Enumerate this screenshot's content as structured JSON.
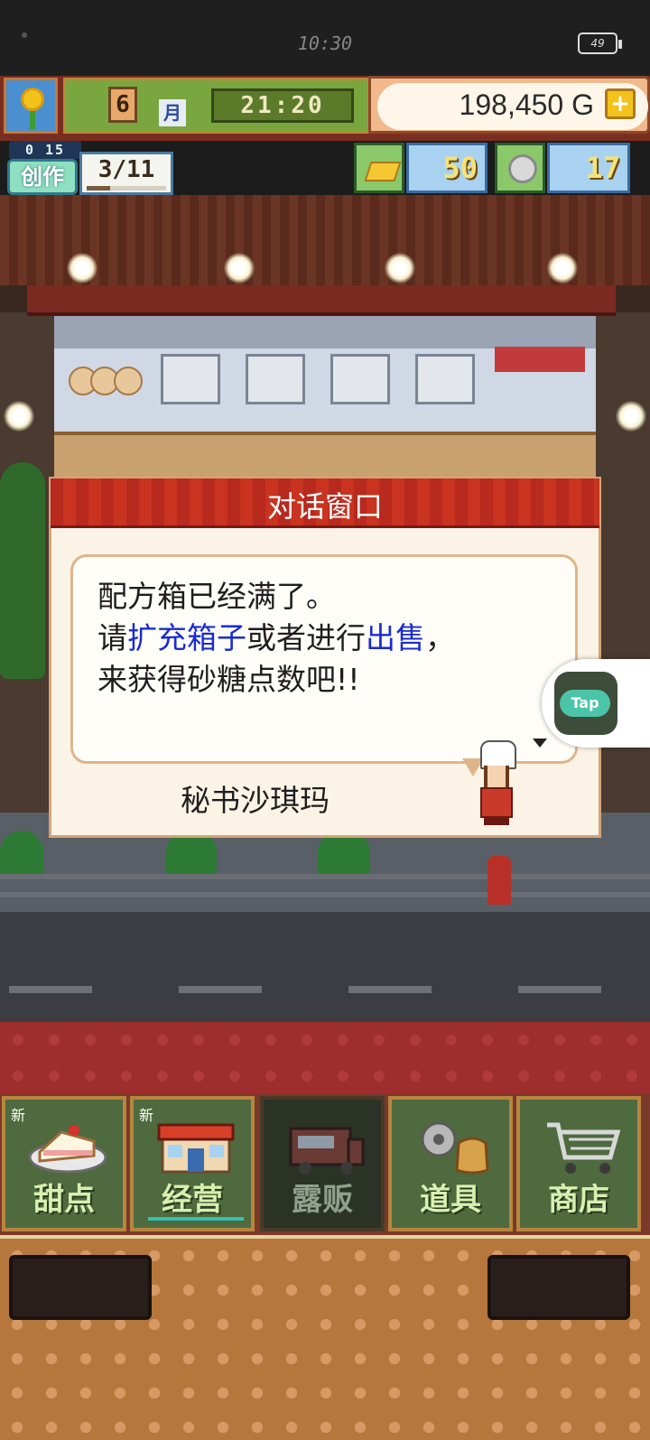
{
  "status_bar": {
    "time": "10:30",
    "battery": "49"
  },
  "hud": {
    "month": "6",
    "month_unit": "月",
    "clock": "21:20",
    "money": "198,450 G",
    "money_add": "+",
    "create_timer": "0 15",
    "create_label": "创作",
    "create_count": "3/11",
    "create_progress": 0.3,
    "gold_bars": "50",
    "silver_coins": "17"
  },
  "dialog": {
    "title": "对话窗口",
    "line1": "配方箱已经满了。",
    "line2_pre": "请",
    "line2_link1": "扩充箱子",
    "line2_mid": "或者进行",
    "line2_link2": "出售",
    "line2_post": "，",
    "line3": "来获得砂糖点数吧!!",
    "speaker": "秘书沙琪玛"
  },
  "tap_button": {
    "label": "Tap"
  },
  "nav": {
    "tabs": [
      {
        "label": "甜点",
        "new": "新",
        "icon": "cake-icon"
      },
      {
        "label": "经营",
        "new": "新",
        "icon": "shop-icon"
      },
      {
        "label": "露贩",
        "new": "",
        "icon": "food-truck-icon"
      },
      {
        "label": "道具",
        "new": "",
        "icon": "items-icon"
      },
      {
        "label": "商店",
        "new": "",
        "icon": "cart-icon"
      }
    ]
  },
  "colors": {
    "highlight": "#1a2bd0",
    "dialog_red": "#c9331f",
    "nav_green": "#4e6a3e"
  }
}
